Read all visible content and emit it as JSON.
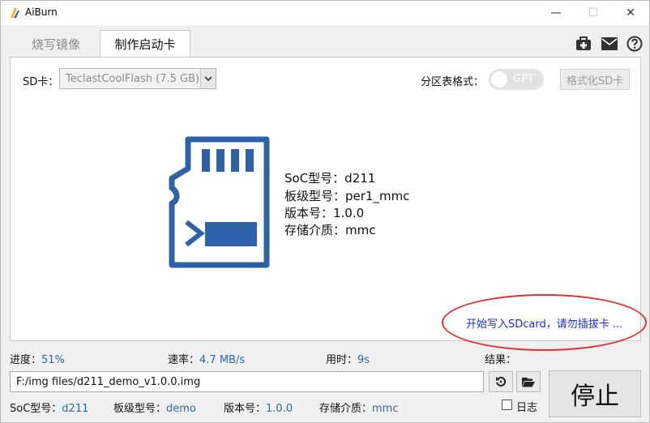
{
  "window": {
    "title": "AiBurn",
    "min_glyph": "—",
    "max_glyph": "☐",
    "close_glyph": "✕"
  },
  "tabs": [
    {
      "label": "烧写镜像",
      "active": false
    },
    {
      "label": "制作启动卡",
      "active": true
    }
  ],
  "top_icons": [
    "first-aid-kit-icon",
    "mail-icon",
    "help-icon"
  ],
  "sd": {
    "label": "SD卡：",
    "selected": "TeclastCoolFlash (7.5 GB)"
  },
  "partition": {
    "label": "分区表格式：",
    "toggle_text": "GPT"
  },
  "format_button": "格式化SD卡",
  "info": {
    "soc": "SoC型号：d211",
    "board": "板级型号：per1_mmc",
    "version": "版本号：1.0.0",
    "storage": "存储介质：mmc"
  },
  "status_message": "开始写入SDcard，请勿插拔卡 ...",
  "stats": {
    "progress_label": "进度：",
    "progress_value": "51%",
    "rate_label": "速率：",
    "rate_value": "4.7 MB/s",
    "time_label": "用时：",
    "time_value": "9s",
    "result_label": "结果："
  },
  "file_path": "F:/img files/d211_demo_v1.0.0.img",
  "stop_button": "停止",
  "log_label": "日志",
  "footer": {
    "soc_label": "SoC型号：",
    "soc_value": "d211",
    "board_label": "板级型号：",
    "board_value": "demo",
    "version_label": "版本号：",
    "version_value": "1.0.0",
    "storage_label": "存储介质：",
    "storage_value": "mmc"
  },
  "colors": {
    "accent_blue": "#2d6aa8",
    "sd_icon_blue": "#2e62a8",
    "status_text": "#1a2ee0",
    "highlight_ellipse": "#e23030"
  }
}
